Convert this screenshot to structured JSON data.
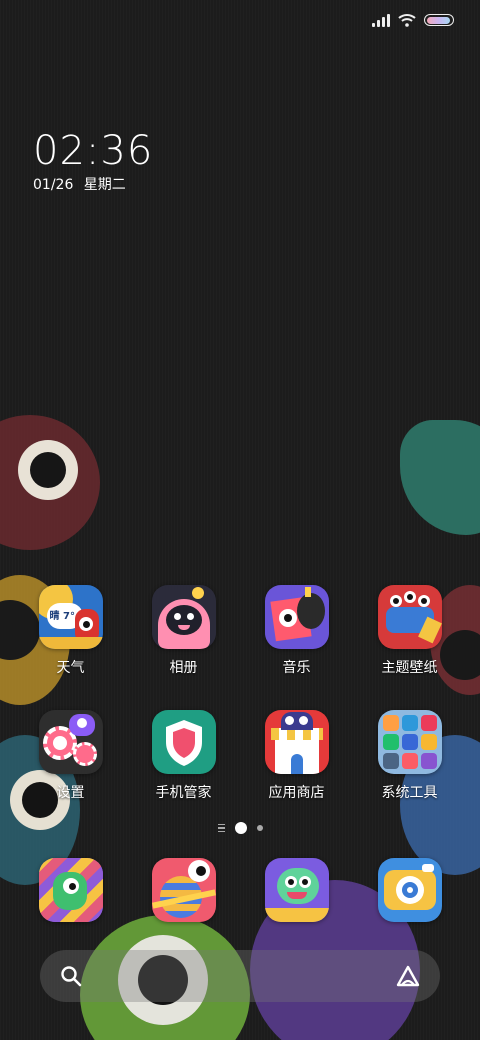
{
  "status_bar": {
    "signal_icon": "signal-bars-icon",
    "wifi_icon": "wifi-icon",
    "battery_icon": "battery-icon",
    "battery_level": 0.95
  },
  "lockclock": {
    "time": "02:36",
    "date": "01/26 星期二"
  },
  "home_row1": [
    {
      "label": "天气",
      "icon": "weather-icon",
      "badge": "晴 7°"
    },
    {
      "label": "相册",
      "icon": "gallery-icon"
    },
    {
      "label": "音乐",
      "icon": "music-icon"
    },
    {
      "label": "主题壁纸",
      "icon": "themes-icon"
    }
  ],
  "home_row2": [
    {
      "label": "设置",
      "icon": "settings-icon"
    },
    {
      "label": "手机管家",
      "icon": "security-icon"
    },
    {
      "label": "应用商店",
      "icon": "app-store-icon"
    },
    {
      "label": "系统工具",
      "icon": "system-tools-folder-icon"
    }
  ],
  "page_indicator": {
    "pages": 2,
    "current": 1
  },
  "dock": [
    "phone-icon",
    "browser-icon",
    "messages-icon",
    "camera-icon"
  ],
  "search": {
    "search_icon": "search-icon",
    "assistant_icon": "assistant-icon"
  }
}
